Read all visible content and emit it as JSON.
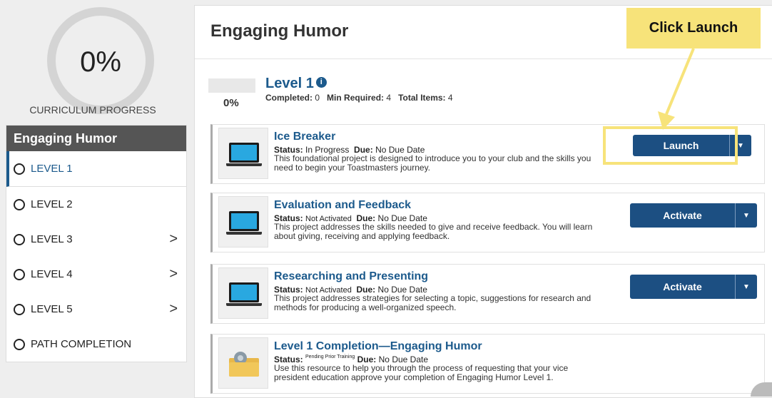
{
  "sidebar": {
    "progress_pct": "0%",
    "progress_label": "CURRICULUM PROGRESS",
    "header": "Engaging Humor",
    "items": [
      {
        "label": "LEVEL 1",
        "active": true,
        "chevron": false
      },
      {
        "label": "LEVEL 2",
        "active": false,
        "chevron": false
      },
      {
        "label": "LEVEL 3",
        "active": false,
        "chevron": true
      },
      {
        "label": "LEVEL 4",
        "active": false,
        "chevron": true
      },
      {
        "label": "LEVEL 5",
        "active": false,
        "chevron": true
      },
      {
        "label": "PATH COMPLETION",
        "active": false,
        "chevron": false
      }
    ],
    "chevron_glyph": ">"
  },
  "main": {
    "title": "Engaging Humor",
    "level": {
      "title": "Level 1",
      "progress_pct": "0%",
      "progress_fraction": 0,
      "completed_label": "Completed:",
      "completed_value": "0",
      "min_required_label": "Min Required:",
      "min_required_value": "4",
      "total_items_label": "Total Items:",
      "total_items_value": "4"
    },
    "projects": [
      {
        "title": "Ice Breaker",
        "status_label": "Status:",
        "status": "In Progress",
        "due_label": "Due:",
        "due": "No Due Date",
        "description": "This foundational project is designed to introduce you to your club and the skills you need to begin your Toastmasters journey.",
        "button": "Launch",
        "icon": "laptop-icon"
      },
      {
        "title": "Evaluation and Feedback",
        "status_label": "Status:",
        "status": "Not Activated",
        "due_label": "Due:",
        "due": "No Due Date",
        "description": "This project addresses the skills needed to give and receive feedback. You will learn about giving, receiving and applying feedback.",
        "button": "Activate",
        "icon": "laptop-icon"
      },
      {
        "title": "Researching and Presenting",
        "status_label": "Status:",
        "status": "Not Activated",
        "due_label": "Due:",
        "due": "No Due Date",
        "description": "This project addresses strategies for selecting a topic, suggestions for research and methods for producing a well-organized speech.",
        "button": "Activate",
        "icon": "laptop-icon"
      },
      {
        "title": "Level 1 Completion—Engaging Humor",
        "status_label": "Status:",
        "status": "Pending Prior Training",
        "due_label": "Due:",
        "due": "No Due Date",
        "description": "Use this resource to help you through the process of requesting that your vice president education approve your completion of Engaging Humor Level 1.",
        "button": "",
        "icon": "folder-icon"
      }
    ]
  },
  "annotation": {
    "callout": "Click Launch"
  },
  "colors": {
    "accent": "#1c5a8c",
    "button": "#1c4f82",
    "highlight": "#f7e37a"
  }
}
